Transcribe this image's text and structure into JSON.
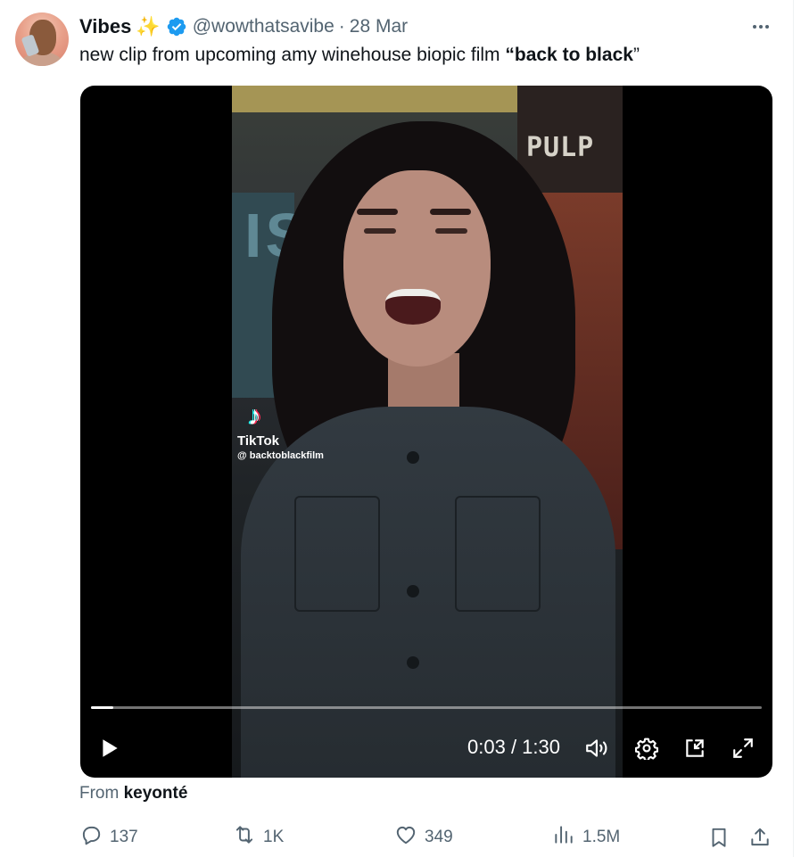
{
  "tweet": {
    "author_name": "Vibes",
    "emoji": "✨",
    "handle": "@wowthatsavibe",
    "separator": "·",
    "date": "28 Mar",
    "text_plain": "new clip from upcoming amy winehouse biopic film ",
    "open_quote": "“",
    "text_bold": "back to black",
    "close_quote": "”"
  },
  "video": {
    "overlay_poster_text": "PULP",
    "overlay_wall_text": "IS",
    "tiktok_brand": "TikTok",
    "tiktok_handle": "@ backtoblackfilm",
    "current_time": "0:03",
    "time_separator": " / ",
    "duration": "1:30",
    "progress_fraction": 0.033
  },
  "attribution": {
    "prefix": "From",
    "source": "keyonté"
  },
  "actions": {
    "replies": "137",
    "reposts": "1K",
    "likes": "349",
    "views": "1.5M"
  },
  "icons": [
    "more-icon",
    "verified-badge-icon",
    "play-icon",
    "volume-icon",
    "settings-gear-icon",
    "pip-icon",
    "fullscreen-icon",
    "reply-icon",
    "repost-icon",
    "like-icon",
    "views-icon",
    "bookmark-icon",
    "share-icon"
  ],
  "colors": {
    "text_primary": "#0f1419",
    "text_secondary": "#536471",
    "verified_blue": "#1d9bf0",
    "video_bg": "#000000"
  }
}
